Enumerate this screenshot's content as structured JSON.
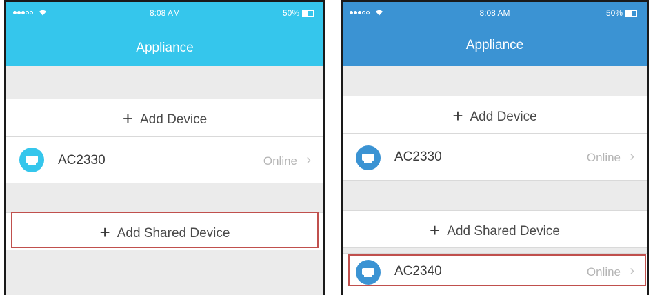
{
  "left_phone": {
    "status_bar": {
      "time": "8:08 AM",
      "battery": "50%"
    },
    "title": "Appliance",
    "add_device_label": "Add Device",
    "device": {
      "name": "AC2330",
      "status": "Online"
    },
    "add_shared_label": "Add Shared Device",
    "accent": "#35c6ec"
  },
  "right_phone": {
    "status_bar": {
      "time": "8:08 AM",
      "battery": "50%"
    },
    "title": "Appliance",
    "add_device_label": "Add Device",
    "devices": [
      {
        "name": "AC2330",
        "status": "Online"
      },
      {
        "name": "AC2340",
        "status": "Online"
      }
    ],
    "add_shared_label": "Add Shared Device",
    "accent": "#3b93d3"
  },
  "highlight_color": "#c0504d"
}
